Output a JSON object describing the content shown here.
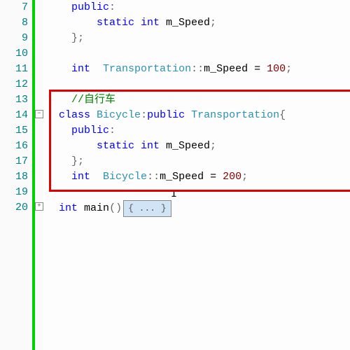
{
  "lineNumbers": [
    "7",
    "8",
    "9",
    "10",
    "11",
    "12",
    "13",
    "14",
    "15",
    "16",
    "17",
    "18",
    "19",
    "20"
  ],
  "code": {
    "l7": {
      "indent": "    ",
      "kw": "public",
      "punct": ":"
    },
    "l8": {
      "indent": "        ",
      "kw": "static int",
      "ident": " m_Speed",
      "punct": ";"
    },
    "l9": {
      "indent": "    ",
      "punct": "};"
    },
    "l10": {
      "indent": ""
    },
    "l11": {
      "indent": "    ",
      "type1": "int",
      "sp": "  ",
      "type2": "Transportation",
      "scope": "::",
      "ident": "m_Speed",
      "eq": " = ",
      "num": "100",
      "semi": ";"
    },
    "l12": {
      "indent": ""
    },
    "l13": {
      "indent": "    ",
      "comment": "//自行车"
    },
    "l14": {
      "indent": "  ",
      "kw": "class",
      "sp": " ",
      "type1": "Bicycle",
      "colon": ":",
      "kw2": "public",
      "sp2": " ",
      "type2": "Transportation",
      "brace": "{"
    },
    "l15": {
      "indent": "    ",
      "kw": "public",
      "punct": ":"
    },
    "l16": {
      "indent": "        ",
      "kw": "static int",
      "ident": " m_Speed",
      "punct": ";"
    },
    "l17": {
      "indent": "    ",
      "punct": "};"
    },
    "l18": {
      "indent": "    ",
      "type1": "int",
      "sp": "  ",
      "type2": "Bicycle",
      "scope": "::",
      "ident": "m_Speed",
      "eq": " = ",
      "num": "200",
      "semi": ";"
    },
    "l19": {
      "indent": ""
    },
    "l20": {
      "indent": "  ",
      "type": "int",
      "sp": " ",
      "ident": "main",
      "parens": "()",
      "fold": "{ ... }"
    }
  },
  "foldMinus": "−",
  "foldPlus": "+"
}
